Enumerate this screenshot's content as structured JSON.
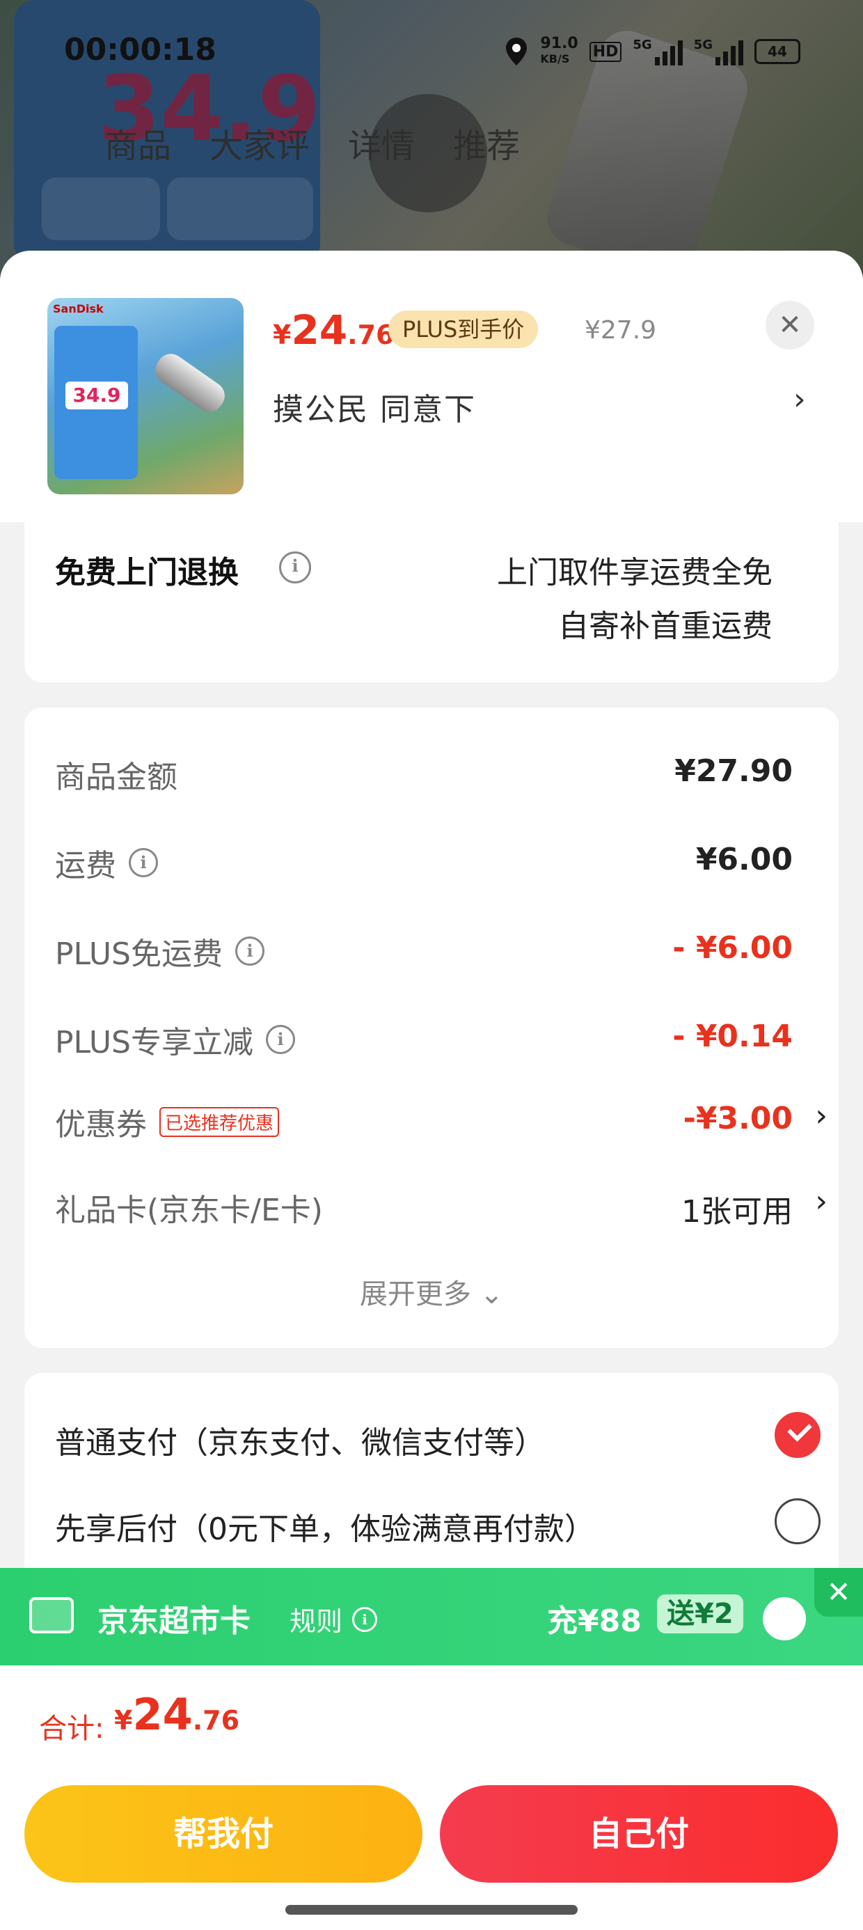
{
  "status_bar": {
    "time": "00:00:18",
    "net_speed": "91.0",
    "net_unit": "KB/S",
    "hd": "HD",
    "sig1": "5G",
    "sig2": "5G",
    "battery": "44"
  },
  "background": {
    "tabs": [
      "商品",
      "大家评",
      "详情",
      "推荐"
    ]
  },
  "product": {
    "price_symbol": "¥",
    "price_int": "24",
    "price_dec": ".76",
    "plus_badge": "PLUS到手价",
    "original_price": "¥27.9",
    "spec": "摸公民  同意下",
    "thumb_brand": "SanDisk",
    "thumb_price": "34.9"
  },
  "return": {
    "title": "免费上门退换",
    "line1": "上门取件享运费全免",
    "line2": "自寄补首重运费"
  },
  "fees": {
    "rows": [
      {
        "label": "商品金额",
        "value": "¥27.90"
      },
      {
        "label": "运费",
        "value": "¥6.00"
      },
      {
        "label": "PLUS免运费",
        "value": "- ¥6.00"
      },
      {
        "label": "PLUS专享立减",
        "value": "- ¥0.14"
      },
      {
        "label": "优惠券",
        "tag": "已选推荐优惠",
        "value": "-¥3.00"
      },
      {
        "label": "礼品卡(京东卡/E卡)",
        "value": "1张可用"
      }
    ],
    "expand": "展开更多"
  },
  "payment": {
    "options": [
      {
        "label": "普通支付（京东支付、微信支付等）",
        "selected": true
      },
      {
        "label": "先享后付（0元下单，体验满意再付款）",
        "selected": false
      }
    ]
  },
  "promo": {
    "title": "京东超市卡",
    "rule": "规则",
    "amount": "充¥88",
    "bonus": "送¥2"
  },
  "total": {
    "label": "合计:",
    "symbol": "¥",
    "int": "24",
    "dec": ".76"
  },
  "buttons": {
    "help": "帮我付",
    "self": "自己付"
  },
  "colors": {
    "accent_red": "#e8321e",
    "green": "#2ccf6f",
    "yellow": "#fbc418"
  }
}
